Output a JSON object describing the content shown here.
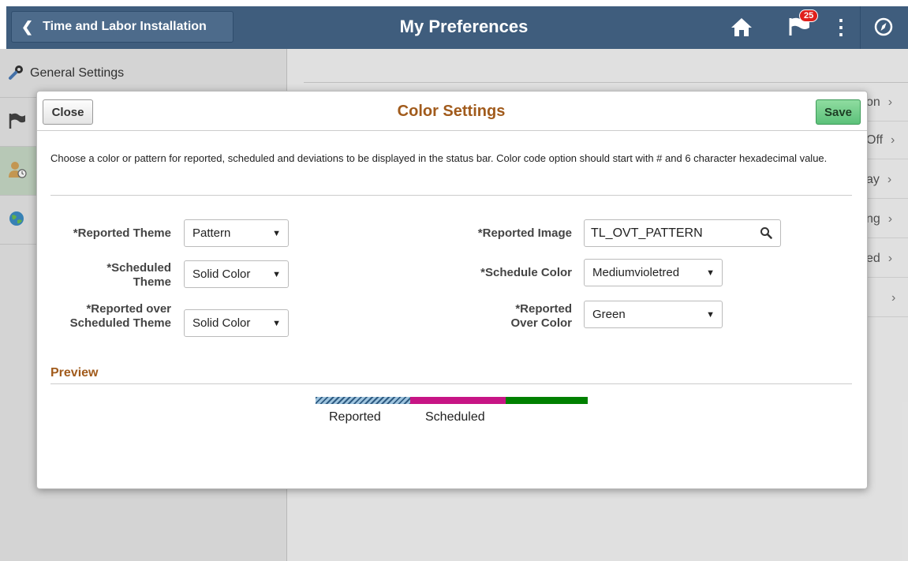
{
  "header": {
    "back_label": "Time and Labor Installation",
    "title": "My Preferences",
    "notification_count": "25",
    "icons": [
      "home-icon",
      "flag-icon",
      "kebab-menu-icon",
      "compass-icon"
    ]
  },
  "sidebar": {
    "items": [
      {
        "label": "General Settings",
        "icon": "wrench-gear-icon"
      },
      {
        "label": "",
        "icon": "flag-icon"
      },
      {
        "label": "",
        "icon": "person-clock-icon",
        "selected": true
      },
      {
        "label": "",
        "icon": "globe-icon"
      }
    ]
  },
  "right_panel": {
    "rows": [
      {
        "text": "on"
      },
      {
        "text": "Off"
      },
      {
        "text": "ay"
      },
      {
        "text": "ng"
      },
      {
        "text": "ed"
      },
      {
        "text": ""
      }
    ]
  },
  "modal": {
    "title": "Color Settings",
    "close_label": "Close",
    "save_label": "Save",
    "instructions": "Choose a color or pattern for reported, scheduled and deviations to be displayed in the status bar. Color code option should start with # and 6 character hexadecimal value.",
    "fields": {
      "reported_theme": {
        "label": "*Reported Theme",
        "value": "Pattern"
      },
      "scheduled_theme": {
        "label": "*Scheduled Theme",
        "value": "Solid Color"
      },
      "reported_over_scheduled_theme": {
        "label": "*Reported over Scheduled Theme",
        "value": "Solid Color"
      },
      "reported_image": {
        "label": "*Reported Image",
        "value": "TL_OVT_PATTERN"
      },
      "schedule_color": {
        "label": "*Schedule Color",
        "value": "Mediumvioletred"
      },
      "reported_over_color": {
        "label": "*Reported Over Color",
        "value": "Green"
      }
    },
    "preview": {
      "title": "Preview",
      "reported_label": "Reported",
      "scheduled_label": "Scheduled",
      "colors": {
        "scheduled": "#c71585",
        "reported_over": "#008000"
      }
    }
  },
  "colors": {
    "header_bg": "#3f5d7d",
    "title_accent": "#a15b1c",
    "save_green": "#5cc17a"
  }
}
